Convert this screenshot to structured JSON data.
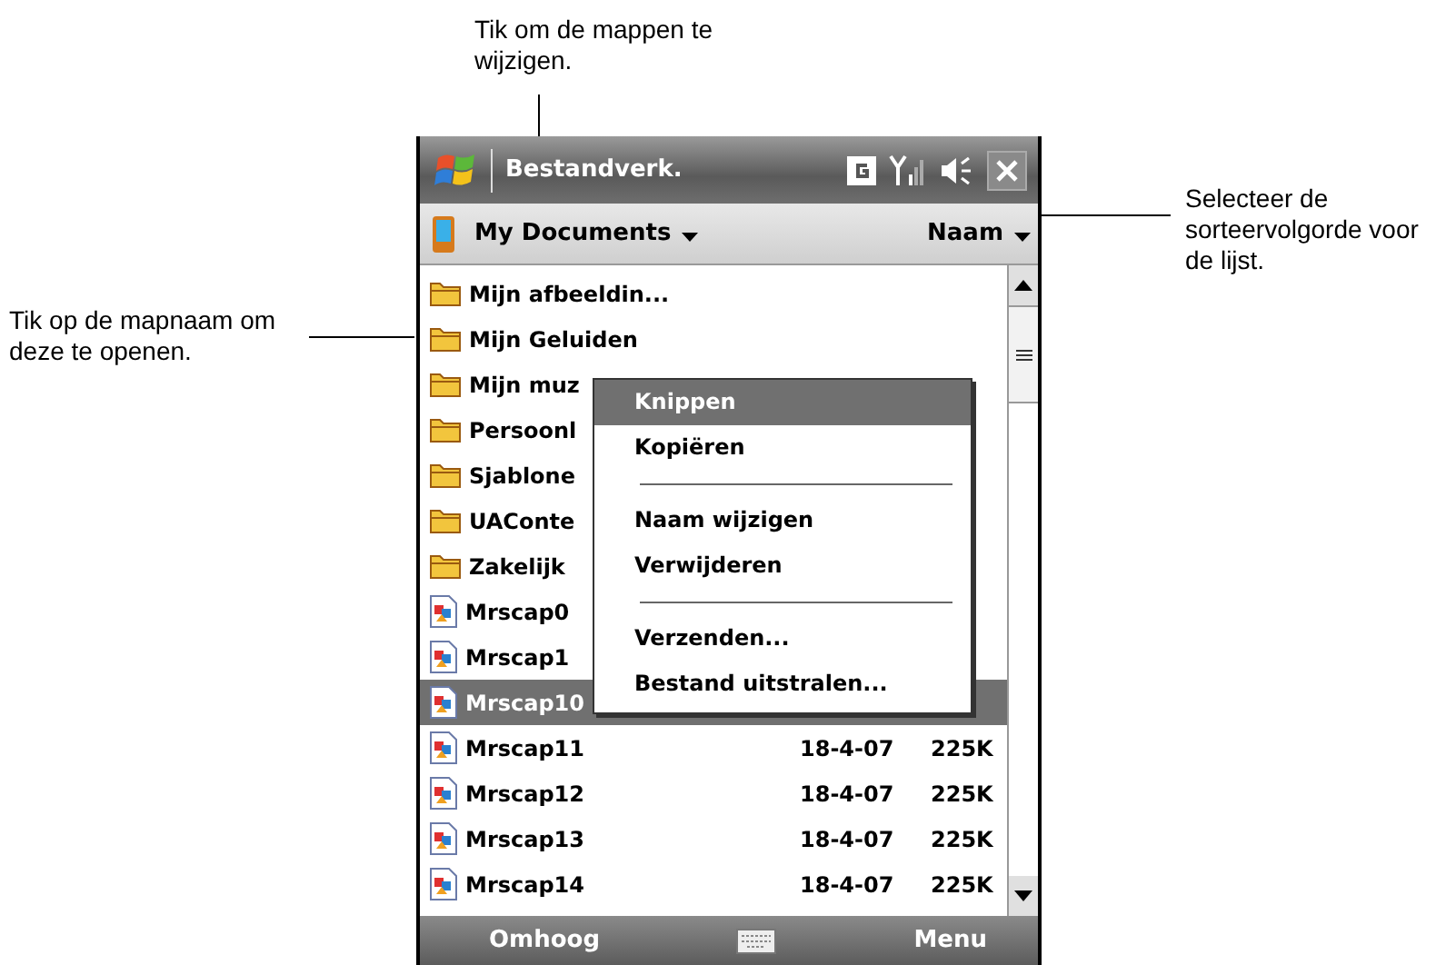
{
  "callouts": [
    {
      "kind": "top",
      "text": "Tik om de mappen te wijzigen."
    },
    {
      "kind": "left",
      "text": "Tik op de mapnaam om deze te openen."
    },
    {
      "kind": "right",
      "text": "Selecteer de sorteervolgorde voor de lijst."
    }
  ],
  "window": {
    "title": "Bestandverk."
  },
  "header": {
    "folder": "My Documents",
    "sort": "Naam"
  },
  "rows": [
    {
      "kind": "folder",
      "name": "Mijn afbeeldin...",
      "selected": false
    },
    {
      "kind": "folder",
      "name": "Mijn Geluiden",
      "selected": false
    },
    {
      "kind": "folder",
      "name": "Mijn muz",
      "selected": false
    },
    {
      "kind": "folder",
      "name": "Persoonl",
      "selected": false
    },
    {
      "kind": "folder",
      "name": "Sjablone",
      "selected": false
    },
    {
      "kind": "folder",
      "name": "UAConte",
      "selected": false
    },
    {
      "kind": "folder",
      "name": "Zakelijk",
      "selected": false
    },
    {
      "kind": "file",
      "name": "Mrscap0",
      "selected": false
    },
    {
      "kind": "file",
      "name": "Mrscap1",
      "selected": false
    },
    {
      "kind": "file",
      "name": "Mrscap10",
      "selected": true
    },
    {
      "kind": "file",
      "name": "Mrscap11",
      "date": "18-4-07",
      "size": "225K",
      "selected": false
    },
    {
      "kind": "file",
      "name": "Mrscap12",
      "date": "18-4-07",
      "size": "225K",
      "selected": false
    },
    {
      "kind": "file",
      "name": "Mrscap13",
      "date": "18-4-07",
      "size": "225K",
      "selected": false
    },
    {
      "kind": "file",
      "name": "Mrscap14",
      "date": "18-4-07",
      "size": "225K",
      "selected": false
    }
  ],
  "context_menu": [
    {
      "kind": "item",
      "label": "Knippen",
      "selected": true
    },
    {
      "kind": "item",
      "label": "Kopiëren",
      "selected": false
    },
    {
      "kind": "separator"
    },
    {
      "kind": "item",
      "label": "Naam wijzigen",
      "selected": false
    },
    {
      "kind": "item",
      "label": "Verwijderen",
      "selected": false
    },
    {
      "kind": "separator"
    },
    {
      "kind": "item",
      "label": "Verzenden...",
      "selected": false
    },
    {
      "kind": "item",
      "label": "Bestand uitstralen...",
      "selected": false
    }
  ],
  "softkeys": {
    "left": "Omhoog",
    "right": "Menu"
  }
}
